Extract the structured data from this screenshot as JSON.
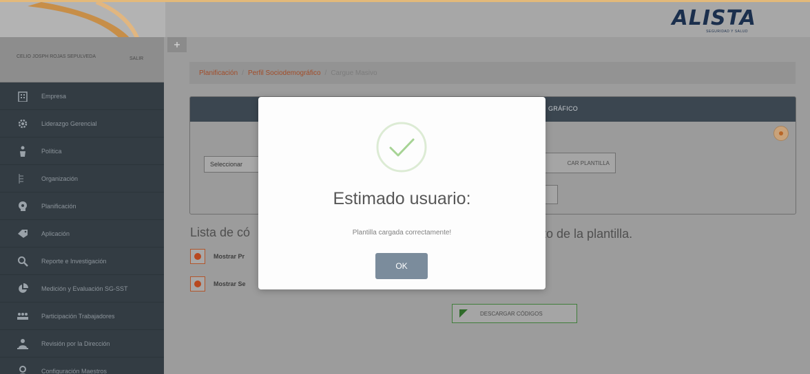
{
  "header": {
    "logo_main": "ALISTA",
    "logo_sub": "SEGURIDAD Y SALUD"
  },
  "sidebar": {
    "user_name": "CELIO JOSPH ROJAS SEPULVEDA",
    "exit_label": "SALIR",
    "items": [
      {
        "label": "Empresa",
        "icon": "building-icon"
      },
      {
        "label": "Liderazgo Gerencial",
        "icon": "gears-icon"
      },
      {
        "label": "Política",
        "icon": "person-podium-icon"
      },
      {
        "label": "Organización",
        "icon": "org-chart-icon"
      },
      {
        "label": "Planificación",
        "icon": "head-gear-icon"
      },
      {
        "label": "Aplicación",
        "icon": "tag-icon"
      },
      {
        "label": "Reporte e Investigación",
        "icon": "magnifier-icon"
      },
      {
        "label": "Medición y Evaluación SG-SST",
        "icon": "pie-chart-icon"
      },
      {
        "label": "Participación Trabajadores",
        "icon": "people-icon"
      },
      {
        "label": "Revisión por la Dirección",
        "icon": "director-icon"
      },
      {
        "label": "Configuración Maestros",
        "icon": "config-user-icon"
      }
    ]
  },
  "breadcrumb": {
    "items": [
      "Planificación",
      "Perfil Sociodemográfico"
    ],
    "current": "Cargue Masivo"
  },
  "panel": {
    "title": "GRÁFICO",
    "select_value": "Seleccionar",
    "upload_label": "CAR PLANTILLA"
  },
  "list": {
    "title_left": "Lista de có",
    "title_right": "nto de la plantilla.",
    "toggles": [
      {
        "label": "Mostrar Pr"
      },
      {
        "label": "Mostrar Se"
      }
    ],
    "download_label": "DESCARGAR CÓDIGOS"
  },
  "modal": {
    "title": "Estimado usuario:",
    "message": "Plantilla cargada correctamente!",
    "ok_label": "OK",
    "icon": "check-circle-icon"
  },
  "colors": {
    "sidebar_bg": "#333c43",
    "accent": "#b8481f",
    "ok_button": "#7b8c9c",
    "success": "#a6d394"
  }
}
